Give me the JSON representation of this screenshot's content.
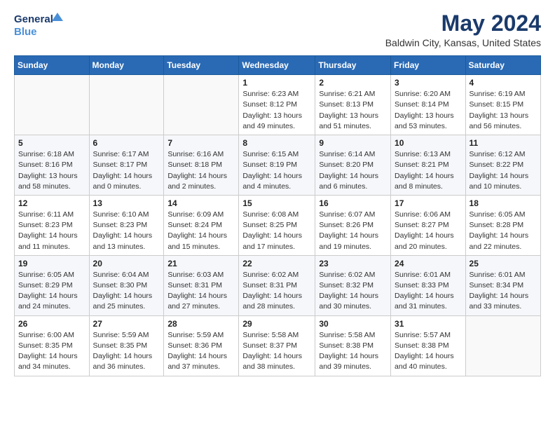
{
  "header": {
    "logo_line1": "General",
    "logo_line2": "Blue",
    "main_title": "May 2024",
    "subtitle": "Baldwin City, Kansas, United States"
  },
  "days_of_week": [
    "Sunday",
    "Monday",
    "Tuesday",
    "Wednesday",
    "Thursday",
    "Friday",
    "Saturday"
  ],
  "weeks": [
    [
      {
        "day": "",
        "info": ""
      },
      {
        "day": "",
        "info": ""
      },
      {
        "day": "",
        "info": ""
      },
      {
        "day": "1",
        "info": "Sunrise: 6:23 AM\nSunset: 8:12 PM\nDaylight: 13 hours\nand 49 minutes."
      },
      {
        "day": "2",
        "info": "Sunrise: 6:21 AM\nSunset: 8:13 PM\nDaylight: 13 hours\nand 51 minutes."
      },
      {
        "day": "3",
        "info": "Sunrise: 6:20 AM\nSunset: 8:14 PM\nDaylight: 13 hours\nand 53 minutes."
      },
      {
        "day": "4",
        "info": "Sunrise: 6:19 AM\nSunset: 8:15 PM\nDaylight: 13 hours\nand 56 minutes."
      }
    ],
    [
      {
        "day": "5",
        "info": "Sunrise: 6:18 AM\nSunset: 8:16 PM\nDaylight: 13 hours\nand 58 minutes."
      },
      {
        "day": "6",
        "info": "Sunrise: 6:17 AM\nSunset: 8:17 PM\nDaylight: 14 hours\nand 0 minutes."
      },
      {
        "day": "7",
        "info": "Sunrise: 6:16 AM\nSunset: 8:18 PM\nDaylight: 14 hours\nand 2 minutes."
      },
      {
        "day": "8",
        "info": "Sunrise: 6:15 AM\nSunset: 8:19 PM\nDaylight: 14 hours\nand 4 minutes."
      },
      {
        "day": "9",
        "info": "Sunrise: 6:14 AM\nSunset: 8:20 PM\nDaylight: 14 hours\nand 6 minutes."
      },
      {
        "day": "10",
        "info": "Sunrise: 6:13 AM\nSunset: 8:21 PM\nDaylight: 14 hours\nand 8 minutes."
      },
      {
        "day": "11",
        "info": "Sunrise: 6:12 AM\nSunset: 8:22 PM\nDaylight: 14 hours\nand 10 minutes."
      }
    ],
    [
      {
        "day": "12",
        "info": "Sunrise: 6:11 AM\nSunset: 8:23 PM\nDaylight: 14 hours\nand 11 minutes."
      },
      {
        "day": "13",
        "info": "Sunrise: 6:10 AM\nSunset: 8:23 PM\nDaylight: 14 hours\nand 13 minutes."
      },
      {
        "day": "14",
        "info": "Sunrise: 6:09 AM\nSunset: 8:24 PM\nDaylight: 14 hours\nand 15 minutes."
      },
      {
        "day": "15",
        "info": "Sunrise: 6:08 AM\nSunset: 8:25 PM\nDaylight: 14 hours\nand 17 minutes."
      },
      {
        "day": "16",
        "info": "Sunrise: 6:07 AM\nSunset: 8:26 PM\nDaylight: 14 hours\nand 19 minutes."
      },
      {
        "day": "17",
        "info": "Sunrise: 6:06 AM\nSunset: 8:27 PM\nDaylight: 14 hours\nand 20 minutes."
      },
      {
        "day": "18",
        "info": "Sunrise: 6:05 AM\nSunset: 8:28 PM\nDaylight: 14 hours\nand 22 minutes."
      }
    ],
    [
      {
        "day": "19",
        "info": "Sunrise: 6:05 AM\nSunset: 8:29 PM\nDaylight: 14 hours\nand 24 minutes."
      },
      {
        "day": "20",
        "info": "Sunrise: 6:04 AM\nSunset: 8:30 PM\nDaylight: 14 hours\nand 25 minutes."
      },
      {
        "day": "21",
        "info": "Sunrise: 6:03 AM\nSunset: 8:31 PM\nDaylight: 14 hours\nand 27 minutes."
      },
      {
        "day": "22",
        "info": "Sunrise: 6:02 AM\nSunset: 8:31 PM\nDaylight: 14 hours\nand 28 minutes."
      },
      {
        "day": "23",
        "info": "Sunrise: 6:02 AM\nSunset: 8:32 PM\nDaylight: 14 hours\nand 30 minutes."
      },
      {
        "day": "24",
        "info": "Sunrise: 6:01 AM\nSunset: 8:33 PM\nDaylight: 14 hours\nand 31 minutes."
      },
      {
        "day": "25",
        "info": "Sunrise: 6:01 AM\nSunset: 8:34 PM\nDaylight: 14 hours\nand 33 minutes."
      }
    ],
    [
      {
        "day": "26",
        "info": "Sunrise: 6:00 AM\nSunset: 8:35 PM\nDaylight: 14 hours\nand 34 minutes."
      },
      {
        "day": "27",
        "info": "Sunrise: 5:59 AM\nSunset: 8:35 PM\nDaylight: 14 hours\nand 36 minutes."
      },
      {
        "day": "28",
        "info": "Sunrise: 5:59 AM\nSunset: 8:36 PM\nDaylight: 14 hours\nand 37 minutes."
      },
      {
        "day": "29",
        "info": "Sunrise: 5:58 AM\nSunset: 8:37 PM\nDaylight: 14 hours\nand 38 minutes."
      },
      {
        "day": "30",
        "info": "Sunrise: 5:58 AM\nSunset: 8:38 PM\nDaylight: 14 hours\nand 39 minutes."
      },
      {
        "day": "31",
        "info": "Sunrise: 5:57 AM\nSunset: 8:38 PM\nDaylight: 14 hours\nand 40 minutes."
      },
      {
        "day": "",
        "info": ""
      }
    ]
  ]
}
